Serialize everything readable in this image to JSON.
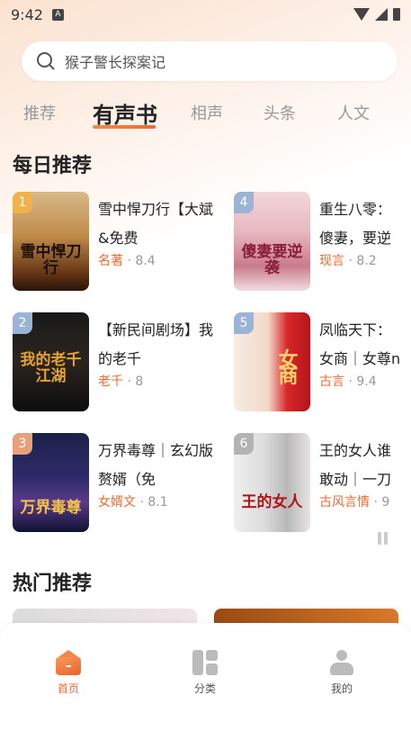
{
  "status_bar": {
    "time": "9:42",
    "notification_badge": "A"
  },
  "search": {
    "query": "猴子警长探案记"
  },
  "tabs": [
    {
      "label": "推荐",
      "active": false
    },
    {
      "label": "有声书",
      "active": true
    },
    {
      "label": "相声",
      "active": false
    },
    {
      "label": "头条",
      "active": false
    },
    {
      "label": "人文",
      "active": false
    }
  ],
  "daily": {
    "title": "每日推荐",
    "books": [
      {
        "rank": "1",
        "title": "雪中悍刀行【大斌&免费",
        "category": "名著",
        "rating": "8.4",
        "cover_text": "雪中悍刀行"
      },
      {
        "rank": "2",
        "title": "【新民间剧场】我的老千",
        "category": "老千",
        "rating": "8",
        "cover_text": "我的老千江湖"
      },
      {
        "rank": "3",
        "title": "万界毒尊｜玄幻版赘婿（免",
        "category": "女婿文",
        "rating": "8.1",
        "cover_text": "万界毒尊"
      },
      {
        "rank": "4",
        "title": "重生八零：傻妻，要逆袭",
        "category": "现言",
        "rating": "8.2",
        "cover_text": "傻妻要逆袭"
      },
      {
        "rank": "5",
        "title": "凤临天下：女商｜女尊np",
        "category": "古言",
        "rating": "9.4",
        "cover_text": "女商"
      },
      {
        "rank": "6",
        "title": "王的女人谁敢动｜一刀苏宫",
        "category": "古风言情",
        "rating": "9",
        "cover_text": "王的女人"
      }
    ]
  },
  "hot": {
    "title": "热门推荐"
  },
  "bottom_nav": [
    {
      "label": "首页",
      "icon": "home-icon",
      "active": true
    },
    {
      "label": "分类",
      "icon": "category-icon",
      "active": false
    },
    {
      "label": "我的",
      "icon": "profile-icon",
      "active": false
    }
  ],
  "colors": {
    "accent": "#f06a2d",
    "rank_badge_gold": "#f0b24a",
    "rank_badge_blue": "#9bb4d6"
  }
}
